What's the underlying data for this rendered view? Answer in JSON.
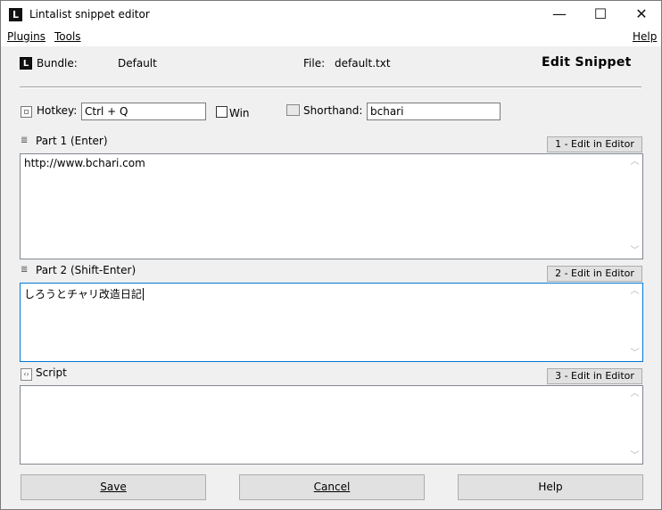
{
  "window": {
    "title": "Lintalist snippet editor",
    "app_icon_letter": "L",
    "controls": {
      "minimize": "—",
      "maximize": "☐",
      "close": "✕"
    }
  },
  "menu": {
    "plugins": "Plugins",
    "tools": "Tools",
    "help": "Help"
  },
  "header": {
    "bundle_label": "Bundle:",
    "bundle_value": "Default",
    "file_label": "File:",
    "file_value": "default.txt",
    "heading": "Edit Snippet"
  },
  "hotkey": {
    "label": "Hotkey:",
    "value": "Ctrl + Q",
    "win_label": "Win",
    "win_checked": false
  },
  "shorthand": {
    "label": "Shorthand:",
    "value": "bchari"
  },
  "part1": {
    "label": "Part 1 (Enter)",
    "edit_button": "1 - Edit in Editor",
    "content": "http://www.bchari.com"
  },
  "part2": {
    "label": "Part 2 (Shift-Enter)",
    "edit_button": "2 - Edit in Editor",
    "content": "しろうとチャリ改造日記"
  },
  "script": {
    "label": "Script",
    "edit_button": "3 - Edit in Editor",
    "content": ""
  },
  "buttons": {
    "save": "Save",
    "cancel": "Cancel",
    "help": "Help"
  }
}
